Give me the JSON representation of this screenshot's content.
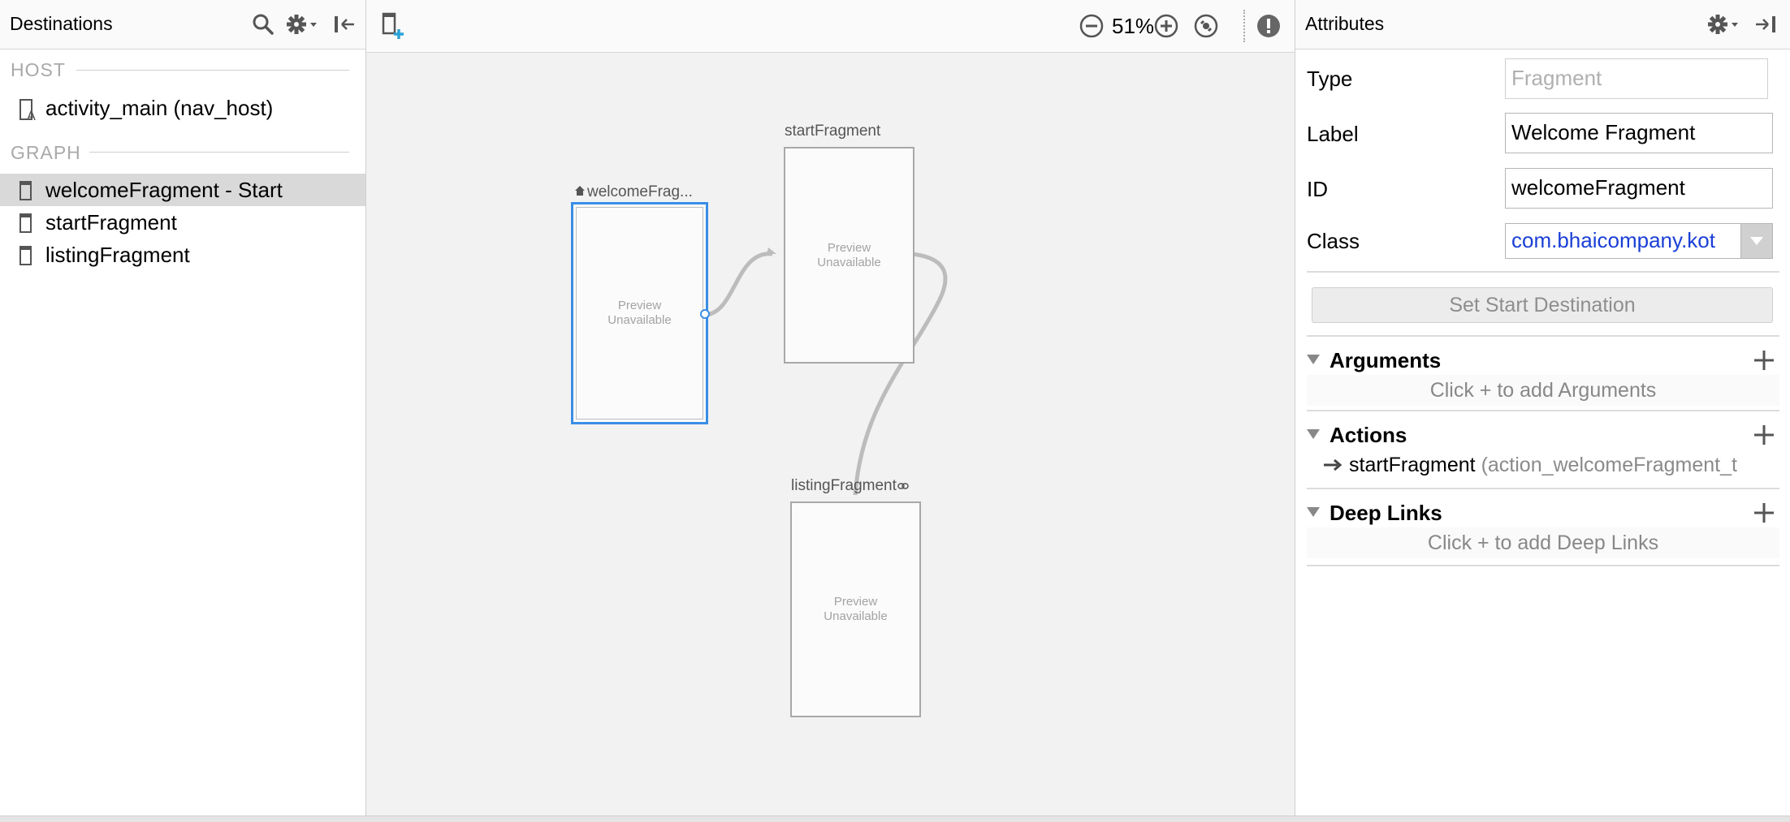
{
  "destinations_panel": {
    "title": "Destinations",
    "host_section_label": "HOST",
    "host_item": "activity_main (nav_host)",
    "graph_section_label": "GRAPH",
    "graph_items": [
      {
        "label": "welcomeFragment - Start",
        "selected": true
      },
      {
        "label": "startFragment",
        "selected": false
      },
      {
        "label": "listingFragment",
        "selected": false
      }
    ]
  },
  "toolbar": {
    "zoom_level": "51%"
  },
  "canvas": {
    "fragments": [
      {
        "label": "welcomeFrag...",
        "preview_line1": "Preview",
        "preview_line2": "Unavailable",
        "selected": true,
        "is_start": true
      },
      {
        "label": "startFragment",
        "preview_line1": "Preview",
        "preview_line2": "Unavailable",
        "selected": false
      },
      {
        "label": "listingFragment",
        "preview_line1": "Preview",
        "preview_line2": "Unavailable",
        "selected": false,
        "has_deep_link": true
      }
    ]
  },
  "attributes_panel": {
    "title": "Attributes",
    "type_label": "Type",
    "type_value": "Fragment",
    "label_label": "Label",
    "label_value": "Welcome Fragment",
    "id_label": "ID",
    "id_value": "welcomeFragment",
    "class_label": "Class",
    "class_value": "com.bhaicompany.kot",
    "set_start_button": "Set Start Destination",
    "arguments": {
      "title": "Arguments",
      "hint": "Click + to add Arguments"
    },
    "actions": {
      "title": "Actions",
      "items": [
        {
          "destination": "startFragment",
          "id": "(action_welcomeFragment_t"
        }
      ]
    },
    "deep_links": {
      "title": "Deep Links",
      "hint": "Click + to add Deep Links"
    }
  },
  "colors": {
    "selection_blue": "#3a8ee6",
    "class_link": "#1a3fd6"
  }
}
